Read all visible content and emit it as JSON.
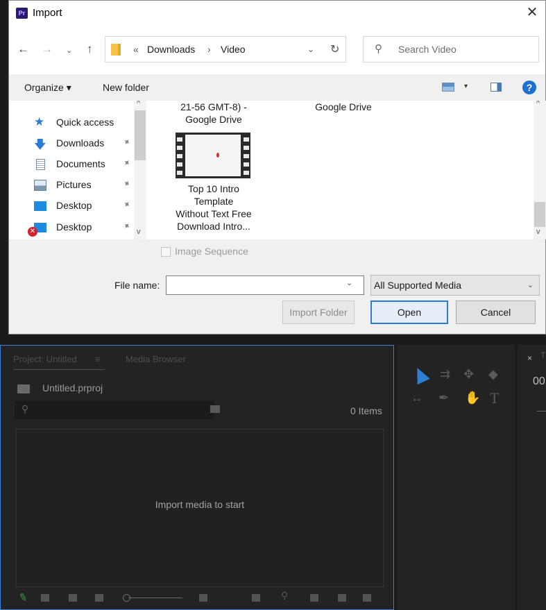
{
  "dialog": {
    "title": "Import",
    "close_glyph": "✕",
    "nav": {
      "back": "←",
      "forward": "→",
      "recent": "⌄",
      "up": "↑",
      "breadcrumb_prefix": "«",
      "breadcrumb": [
        "Downloads",
        "Video"
      ],
      "breadcrumb_sep": "›",
      "address_dropdown": "⌄",
      "refresh": "↻",
      "search_placeholder": "Search Video"
    },
    "toolbar": {
      "organize": "Organize ▾",
      "new_folder": "New folder",
      "view_dropdown": "▾",
      "help": "?"
    },
    "nav_items": [
      {
        "label": "Quick access",
        "icon": "star-icon",
        "pinned": false
      },
      {
        "label": "Downloads",
        "icon": "download-arrow-icon",
        "pinned": true
      },
      {
        "label": "Documents",
        "icon": "document-icon",
        "pinned": true
      },
      {
        "label": "Pictures",
        "icon": "pictures-icon",
        "pinned": true
      },
      {
        "label": "Desktop",
        "icon": "desktop-icon",
        "pinned": true
      },
      {
        "label": "Desktop",
        "icon": "desktop-error-icon",
        "pinned": true
      }
    ],
    "files": {
      "partial_caption_1": [
        "21-56 GMT-8) -",
        "Google Drive"
      ],
      "partial_caption_2": [
        "Google Drive"
      ],
      "video_caption": [
        "Top 10 Intro",
        "Template",
        "Without Text Free",
        "Download Intro..."
      ]
    },
    "image_sequence_label": "Image Sequence",
    "file_name_label": "File name:",
    "file_name_value": "",
    "file_type": "All Supported Media",
    "buttons": {
      "import_folder": "Import Folder",
      "open": "Open",
      "cancel": "Cancel"
    },
    "scroll_up": "^",
    "scroll_down": "v",
    "pin_glyph": "📌"
  },
  "premiere": {
    "project_tab": "Project: Untitled",
    "project_tab_menu": "≡",
    "media_browser_tab": "Media Browser",
    "project_file": "Untitled.prproj",
    "items_count": "0 Items",
    "empty_message": "Import media to start",
    "right_tab_close": "×",
    "right_tab_partial": "T",
    "timecode_partial": "00"
  },
  "colors": {
    "accent_blue": "#2d7ad6",
    "panel_bg": "#232323",
    "panel_border": "#3b7fd1"
  }
}
